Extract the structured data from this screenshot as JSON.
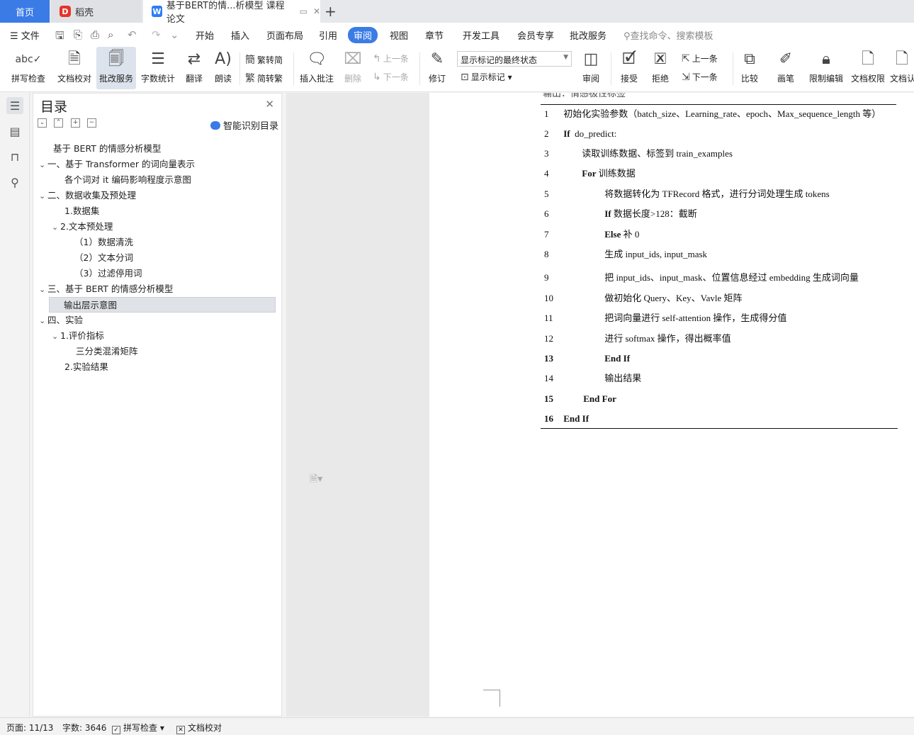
{
  "tabs": {
    "home": "首页",
    "daoke": "稻壳",
    "doc": "基于BERT的情...析模型 课程论文"
  },
  "menu": {
    "file": "文件",
    "items": [
      "开始",
      "插入",
      "页面布局",
      "引用",
      "审阅",
      "视图",
      "章节",
      "开发工具",
      "会员专享",
      "批改服务"
    ],
    "active": "审阅",
    "search": "查找命令、搜索模板"
  },
  "ribbon": {
    "spell_check": "拼写检查",
    "doc_proof": "文档校对",
    "review_service": "批改服务",
    "word_count": "字数统计",
    "translate": "翻译",
    "read_aloud": "朗读",
    "trad_to_simp": "繁转简",
    "simp_to_trad": "简转繁",
    "insert_comment": "插入批注",
    "delete": "删除",
    "prev_comment": "上一条",
    "next_comment": "下一条",
    "revise": "修订",
    "track_state": "显示标记的最终状态",
    "show_markup": "显示标记",
    "review": "审阅",
    "accept": "接受",
    "reject": "拒绝",
    "prev_change": "上一条",
    "next_change": "下一条",
    "compare": "比较",
    "pen": "画笔",
    "restrict_edit": "限制编辑",
    "doc_permission": "文档权限",
    "doc_cut": "文档认"
  },
  "toc": {
    "title": "目录",
    "smart": "智能识别目录",
    "items": [
      {
        "text": "基于 BERT 的情感分析模型"
      },
      {
        "text": "一、基于 Transformer 的词向量表示"
      },
      {
        "text": "各个词对  it  编码影响程度示意图"
      },
      {
        "text": "二、数据收集及预处理"
      },
      {
        "text": "1.数据集"
      },
      {
        "text": "2.文本预处理"
      },
      {
        "text": "（1）数据清洗"
      },
      {
        "text": "（2）文本分词"
      },
      {
        "text": "（3）过滤停用词"
      },
      {
        "text": "三、基于 BERT 的情感分析模型"
      },
      {
        "text": "输出层示意图"
      },
      {
        "text": "四、实验"
      },
      {
        "text": "1.评价指标"
      },
      {
        "text": "三分类混淆矩阵"
      },
      {
        "text": "2.实验结果"
      }
    ]
  },
  "document": {
    "cut_header": "输出：情感极性标签",
    "lines": [
      {
        "n": "1",
        "kw": "",
        "text": "初始化实验参数（batch_size、Learning_rate、epoch、Max_sequence_length 等）"
      },
      {
        "n": "2",
        "kw": "If",
        "text": "do_predict:"
      },
      {
        "n": "3",
        "kw": "",
        "text": "读取训练数据、标签到 train_examples"
      },
      {
        "n": "4",
        "kw": "For",
        "text": "训练数据"
      },
      {
        "n": "5",
        "kw": "",
        "text": "将数据转化为 TFRecord 格式，进行分词处理生成 tokens"
      },
      {
        "n": "6",
        "kw": "If",
        "text": "数据长度>128：截断"
      },
      {
        "n": "7",
        "kw": "Else",
        "text": "补 0"
      },
      {
        "n": "8",
        "kw": "",
        "text": "生成 input_ids, input_mask"
      },
      {
        "n": "9",
        "kw": "",
        "text": "把 input_ids、input_mask、位置信息经过 embedding 生成词向量"
      },
      {
        "n": "10",
        "kw": "",
        "text": "做初始化 Query、Key、Vavle 矩阵"
      },
      {
        "n": "11",
        "kw": "",
        "text": "把词向量进行 self-attention 操作，生成得分值"
      },
      {
        "n": "12",
        "kw": "",
        "text": "进行 softmax 操作，得出概率值"
      },
      {
        "n": "13",
        "kw": "End If",
        "text": ""
      },
      {
        "n": "14",
        "kw": "",
        "text": "输出结果"
      },
      {
        "n": "15",
        "kw": "End For",
        "text": ""
      },
      {
        "n": "16",
        "kw": "End If",
        "text": ""
      }
    ]
  },
  "status": {
    "page": "页面: 11/13",
    "words": "字数: 3646",
    "spell": "拼写检查",
    "proof": "文档校对"
  }
}
